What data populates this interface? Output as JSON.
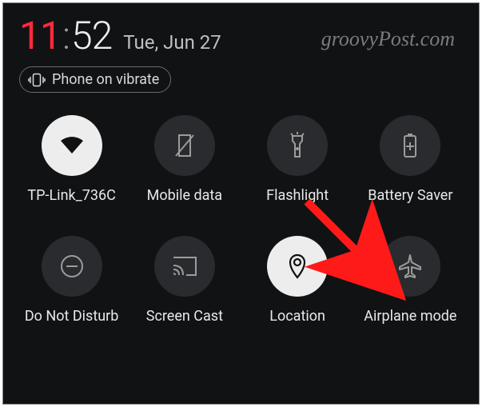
{
  "watermark": "groovyPost.com",
  "clock": {
    "hour": "11",
    "colon": ":",
    "minute": "52"
  },
  "date": "Tue, Jun 27",
  "vibrate_label": "Phone on vibrate",
  "tiles": {
    "wifi": {
      "label": "TP-Link_736C",
      "active": true
    },
    "mobiledata": {
      "label": "Mobile data",
      "active": false
    },
    "flashlight": {
      "label": "Flashlight",
      "active": false
    },
    "battery": {
      "label": "Battery Saver",
      "active": false
    },
    "dnd": {
      "label": "Do Not Disturb",
      "active": false
    },
    "cast": {
      "label": "Screen Cast",
      "active": false
    },
    "location": {
      "label": "Location",
      "active": true
    },
    "airplane": {
      "label": "Airplane mode",
      "active": false
    }
  }
}
